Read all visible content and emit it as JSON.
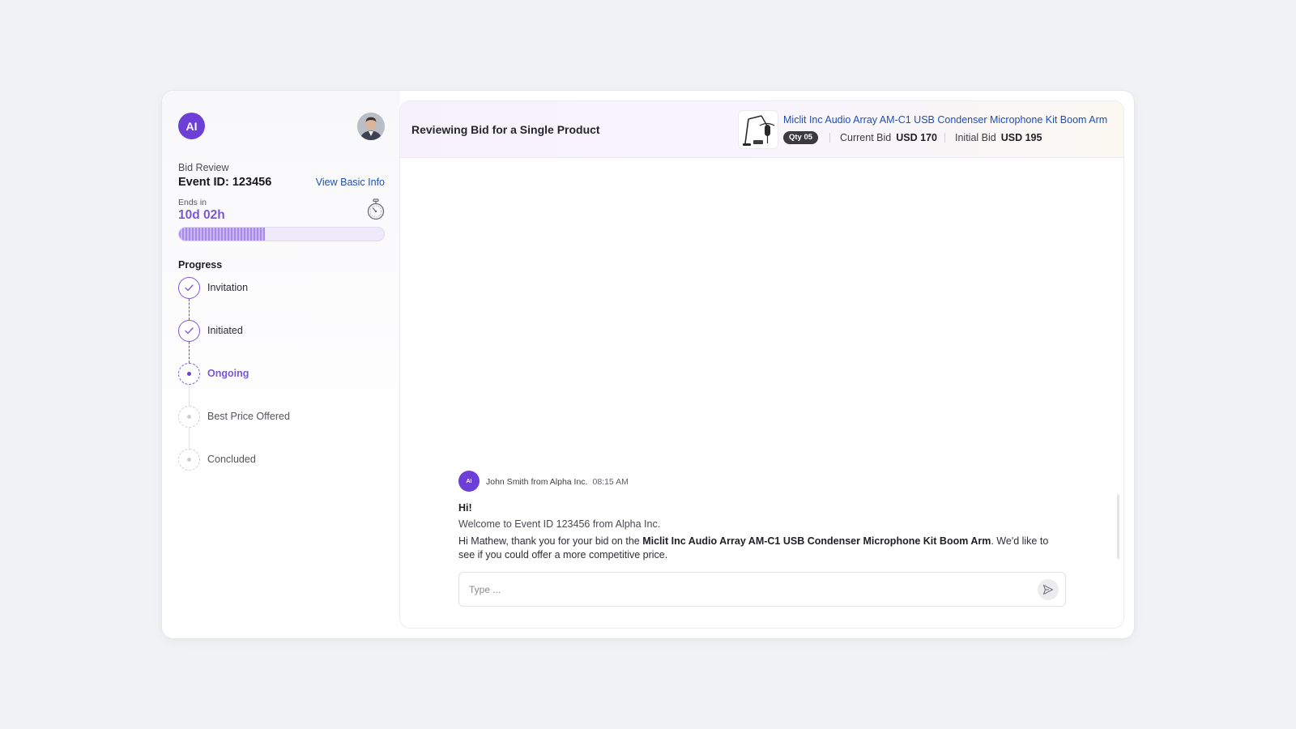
{
  "sidebar": {
    "logo_text": "AI",
    "bid_label": "Bid Review",
    "event_id": "Event ID: 123456",
    "view_basic_info": "View Basic Info",
    "ends_label": "Ends in",
    "ends_value": "10d 02h",
    "time_elapsed_fraction": 0.42,
    "progress_heading": "Progress",
    "steps": [
      {
        "label": "Invitation",
        "state": "done"
      },
      {
        "label": "Initiated",
        "state": "done"
      },
      {
        "label": "Ongoing",
        "state": "active"
      },
      {
        "label": "Best Price Offered",
        "state": "pending"
      },
      {
        "label": "Concluded",
        "state": "pending"
      }
    ]
  },
  "header": {
    "title": "Reviewing Bid for a Single Product",
    "product_name": "Miclit Inc Audio Array AM-C1 USB Condenser Microphone Kit Boom Arm",
    "qty": "Qty 05",
    "current_bid_label": "Current Bid",
    "current_bid_value": "USD 170",
    "initial_bid_label": "Initial Bid",
    "initial_bid_value": "USD 195"
  },
  "chat": {
    "message": {
      "avatar_text": "AI",
      "sender": "John Smith from Alpha Inc.",
      "time": "08:15 AM",
      "greeting": "Hi!",
      "welcome": "Welcome to Event ID 123456 from Alpha Inc.",
      "body_prefix": "Hi Mathew, thank you for your bid on the ",
      "body_product": "Miclit Inc Audio Array AM-C1 USB Condenser Microphone Kit Boom Arm",
      "body_suffix": ". We'd like to see if you could offer a more competitive price."
    },
    "input_placeholder": "Type ..."
  },
  "colors": {
    "accent": "#6d3fd6",
    "accent_light": "#7b57d6",
    "link": "#1f4fb4",
    "background": "#f1f2f4"
  },
  "icons": {
    "logo": "ai-logo-icon",
    "avatar": "user-avatar",
    "timer": "stopwatch-icon",
    "step_done": "check-icon",
    "step_active": "dot-icon",
    "send": "send-icon"
  }
}
